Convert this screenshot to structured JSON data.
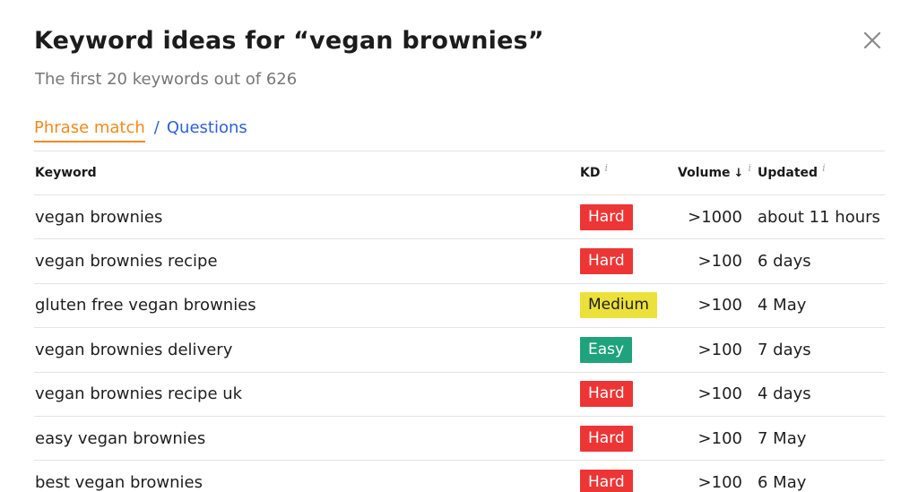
{
  "modal": {
    "title": "Keyword ideas for “vegan brownies”",
    "subtitle": "The first 20 keywords out of 626"
  },
  "tabs": {
    "phrase_match": "Phrase match",
    "separator": "/",
    "questions": "Questions"
  },
  "table": {
    "headers": {
      "keyword": "Keyword",
      "kd": "KD",
      "volume": "Volume",
      "updated": "Updated",
      "info_glyph": "i",
      "sort_glyph": "↓"
    },
    "rows": [
      {
        "keyword": "vegan brownies",
        "kd": "Hard",
        "kd_level": "hard",
        "volume": ">1000",
        "updated": "about 11 hours"
      },
      {
        "keyword": "vegan brownies recipe",
        "kd": "Hard",
        "kd_level": "hard",
        "volume": ">100",
        "updated": "6 days"
      },
      {
        "keyword": "gluten free vegan brownies",
        "kd": "Medium",
        "kd_level": "medium",
        "volume": ">100",
        "updated": "4 May"
      },
      {
        "keyword": "vegan brownies delivery",
        "kd": "Easy",
        "kd_level": "easy",
        "volume": ">100",
        "updated": "7 days"
      },
      {
        "keyword": "vegan brownies recipe uk",
        "kd": "Hard",
        "kd_level": "hard",
        "volume": ">100",
        "updated": "4 days"
      },
      {
        "keyword": "easy vegan brownies",
        "kd": "Hard",
        "kd_level": "hard",
        "volume": ">100",
        "updated": "7 May"
      },
      {
        "keyword": "best vegan brownies",
        "kd": "Hard",
        "kd_level": "hard",
        "volume": ">100",
        "updated": "6 May"
      }
    ]
  },
  "colors": {
    "accent_orange": "#f08a1c",
    "link_blue": "#2d5fd9",
    "hard": "#ee3535",
    "medium": "#ece13a",
    "easy": "#1fa37d"
  },
  "icons": {
    "close": "close-icon",
    "sort": "arrow-down-icon",
    "info": "info-icon"
  }
}
